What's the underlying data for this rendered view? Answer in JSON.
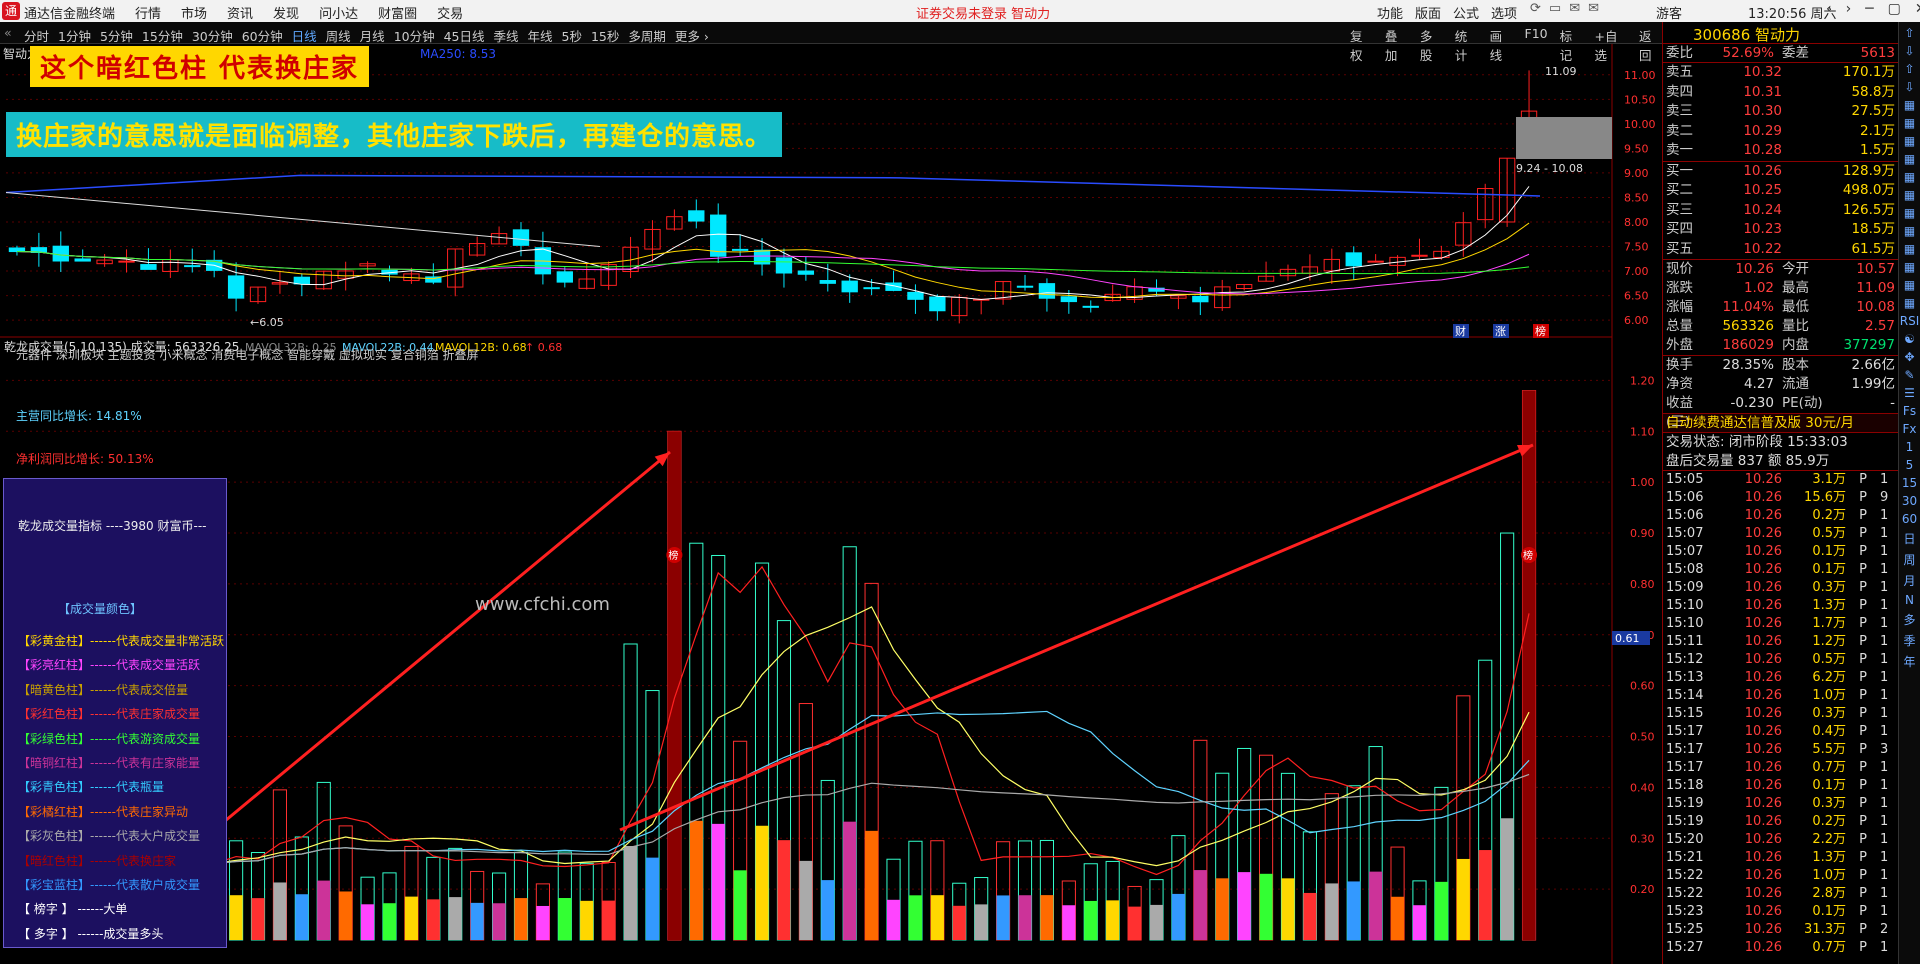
{
  "app": {
    "title": "通达信金融终端",
    "logo": "通",
    "menu": [
      "行情",
      "市场",
      "资讯",
      "发现",
      "问小达",
      "财富圈",
      "交易"
    ],
    "status": "证券交易未登录  智动力",
    "right_menu": [
      "功能",
      "版面",
      "公式",
      "选项"
    ],
    "guest": "游客",
    "clock": "13:20:56 周六",
    "window_controls": [
      "‹",
      "›",
      "─",
      "▢",
      "✕"
    ]
  },
  "tabs": {
    "arrow": "«",
    "items": [
      "分时",
      "1分钟",
      "5分钟",
      "15分钟",
      "30分钟",
      "60分钟",
      "日线",
      "周线",
      "月线",
      "10分钟",
      "45日线",
      "季线",
      "年线",
      "5秒",
      "15秒",
      "多周期",
      "更多 ›"
    ],
    "active": "日线",
    "right": [
      "复权",
      "叠加",
      "多股",
      "统计",
      "画线",
      "F10",
      "标记",
      "+自选",
      "返回"
    ]
  },
  "kline": {
    "name": "智动力",
    "ma_label": "MA250: 8.53",
    "ma_color": "#2a4cff",
    "high_label": "11.09",
    "low_label": "←6.05",
    "range_label": "9.24 - 10.08",
    "y_ticks": [
      "11.00",
      "10.50",
      "10.00",
      "9.50",
      "9.00",
      "8.50",
      "8.00",
      "7.50",
      "7.00",
      "6.50",
      "6.00"
    ],
    "badges": [
      "财",
      "涨",
      "榜"
    ]
  },
  "callouts": {
    "top": "这个暗红色柱   代表换庄家",
    "bottom": "换庄家的意思就是面临调整，其他庄家下跌后，再建仓的意思。"
  },
  "volume": {
    "indicator": "乾龙成交量(5,10,135)",
    "vol_label": "成交量: 563326.25",
    "mavol32b": "MAVOL32B: 0.25",
    "mavol22b": "MAVOL22B: 0.44",
    "mavol12b": "MAVOL12B: 0.68",
    "neg": "↑ 0.68",
    "concepts": "元器件 深圳板块 主题投资 小米概念 消费电子概念 智能穿戴 虚拟现实 复合铜箔 折叠屏",
    "rev_growth": "主营同比增长: 14.81%",
    "profit_growth": "净利润同比增长: 50.13%",
    "y_ticks": [
      "1.20",
      "1.10",
      "1.00",
      "0.90",
      "0.80",
      "0.70",
      "0.60",
      "0.50",
      "0.40",
      "0.30",
      "0.20"
    ],
    "current_tag": "0.61",
    "watermark": "www.cfchi.com",
    "bang": "榜"
  },
  "legend": {
    "title": "乾龙成交量指标 ----3980 财富币---",
    "subtitle": "【成交量颜色】",
    "rows": [
      {
        "text": "【彩黄金柱】------代表成交量非常活跃",
        "color": "#ffd700"
      },
      {
        "text": "【彩亮红柱】------代表成交量活跃",
        "color": "#ff44ff"
      },
      {
        "text": "【暗黄色柱】------代表成交倍量",
        "color": "#c8a000"
      },
      {
        "text": "【彩红色柱】------代表庄家成交量",
        "color": "#ff3030"
      },
      {
        "text": "【彩绿色柱】------代表游资成交量",
        "color": "#33ff33"
      },
      {
        "text": "【暗铜红柱】------代表有庄家能量",
        "color": "#cc3399"
      },
      {
        "text": "【彩青色柱】------代表瓶量",
        "color": "#33ccff"
      },
      {
        "text": "【彩橘红柱】------代表庄家异动",
        "color": "#ff6a00"
      },
      {
        "text": "【彩灰色柱】------代表大户成交量",
        "color": "#aaaaaa"
      },
      {
        "text": "【暗红色柱】------代表换庄家",
        "color": "#aa0000"
      },
      {
        "text": "【彩宝蓝柱】------代表散户成交量",
        "color": "#3399ff"
      },
      {
        "text": "【 榜字 】  ------大单",
        "color": "#ffffff"
      },
      {
        "text": "【 多字 】  ------成交量多头",
        "color": "#ffffff"
      }
    ]
  },
  "stock": {
    "code_name": "300686 智动力",
    "wb": {
      "l": "委比",
      "v": "52.69%",
      "l2": "委差",
      "v2": "5613"
    },
    "asks": [
      {
        "l": "卖五",
        "p": "10.32",
        "v": "170.1万"
      },
      {
        "l": "卖四",
        "p": "10.31",
        "v": "58.8万"
      },
      {
        "l": "卖三",
        "p": "10.30",
        "v": "27.5万"
      },
      {
        "l": "卖二",
        "p": "10.29",
        "v": "2.1万"
      },
      {
        "l": "卖一",
        "p": "10.28",
        "v": "1.5万"
      }
    ],
    "bids": [
      {
        "l": "买一",
        "p": "10.26",
        "v": "128.9万"
      },
      {
        "l": "买二",
        "p": "10.25",
        "v": "498.0万"
      },
      {
        "l": "买三",
        "p": "10.24",
        "v": "126.5万"
      },
      {
        "l": "买四",
        "p": "10.23",
        "v": "18.5万"
      },
      {
        "l": "买五",
        "p": "10.22",
        "v": "61.5万"
      }
    ],
    "quote": [
      {
        "l": "现价",
        "v": "10.26",
        "c1": "red",
        "l2": "今开",
        "v2": "10.57",
        "c2": "red"
      },
      {
        "l": "涨跌",
        "v": "1.02",
        "c1": "red",
        "l2": "最高",
        "v2": "11.09",
        "c2": "red"
      },
      {
        "l": "涨幅",
        "v": "11.04%",
        "c1": "red",
        "l2": "最低",
        "v2": "10.08",
        "c2": "red"
      },
      {
        "l": "总量",
        "v": "563326",
        "c1": "yel",
        "l2": "量比",
        "v2": "2.57",
        "c2": "red"
      },
      {
        "l": "外盘",
        "v": "186029",
        "c1": "red",
        "l2": "内盘",
        "v2": "377297",
        "c2": "grn"
      }
    ],
    "fund": [
      {
        "l": "换手",
        "v": "28.35%",
        "l2": "股本",
        "v2": "2.66亿"
      },
      {
        "l": "净资",
        "v": "4.27",
        "l2": "流通",
        "v2": "1.99亿"
      },
      {
        "l": "收益(三)",
        "v": "-0.230",
        "l2": "PE(动)",
        "v2": "-"
      }
    ],
    "promo": "自动续费通达信普及版  30元/月",
    "trade_state": "交易状态: 闭市阶段 15:33:03",
    "after_hours": "盘后交易量 837 额 85.9万",
    "ticks": [
      [
        "15:05",
        "10.26",
        "3.1万",
        "P",
        "1"
      ],
      [
        "15:06",
        "10.26",
        "15.6万",
        "P",
        "9"
      ],
      [
        "15:06",
        "10.26",
        "0.2万",
        "P",
        "1"
      ],
      [
        "15:07",
        "10.26",
        "0.5万",
        "P",
        "1"
      ],
      [
        "15:07",
        "10.26",
        "0.1万",
        "P",
        "1"
      ],
      [
        "15:08",
        "10.26",
        "0.1万",
        "P",
        "1"
      ],
      [
        "15:09",
        "10.26",
        "0.3万",
        "P",
        "1"
      ],
      [
        "15:10",
        "10.26",
        "1.3万",
        "P",
        "1"
      ],
      [
        "15:10",
        "10.26",
        "1.7万",
        "P",
        "1"
      ],
      [
        "15:11",
        "10.26",
        "1.2万",
        "P",
        "1"
      ],
      [
        "15:12",
        "10.26",
        "0.5万",
        "P",
        "1"
      ],
      [
        "15:13",
        "10.26",
        "6.2万",
        "P",
        "1"
      ],
      [
        "15:14",
        "10.26",
        "1.0万",
        "P",
        "1"
      ],
      [
        "15:15",
        "10.26",
        "0.3万",
        "P",
        "1"
      ],
      [
        "15:17",
        "10.26",
        "0.4万",
        "P",
        "1"
      ],
      [
        "15:17",
        "10.26",
        "5.5万",
        "P",
        "3"
      ],
      [
        "15:17",
        "10.26",
        "0.7万",
        "P",
        "1"
      ],
      [
        "15:18",
        "10.26",
        "0.1万",
        "P",
        "1"
      ],
      [
        "15:19",
        "10.26",
        "0.3万",
        "P",
        "1"
      ],
      [
        "15:19",
        "10.26",
        "0.2万",
        "P",
        "1"
      ],
      [
        "15:20",
        "10.26",
        "2.2万",
        "P",
        "1"
      ],
      [
        "15:21",
        "10.26",
        "1.3万",
        "P",
        "1"
      ],
      [
        "15:22",
        "10.26",
        "1.0万",
        "P",
        "1"
      ],
      [
        "15:22",
        "10.26",
        "2.8万",
        "P",
        "1"
      ],
      [
        "15:23",
        "10.26",
        "0.1万",
        "P",
        "1"
      ],
      [
        "15:25",
        "10.26",
        "31.3万",
        "P",
        "2"
      ],
      [
        "15:27",
        "10.26",
        "0.7万",
        "P",
        "1"
      ]
    ]
  },
  "side_icons": [
    "⇧",
    "⇩",
    "⇧",
    "⇩",
    "▦",
    "▦",
    "▦",
    "▦",
    "▦",
    "▦",
    "▦",
    "▦",
    "▦",
    "▦",
    "▦",
    "▦",
    "RSI",
    "☯",
    "✥",
    "✎",
    "☰",
    "Fs",
    "Fx",
    "1",
    "5",
    "15",
    "30",
    "60",
    "日",
    "周",
    "月",
    "N",
    "多",
    "季",
    "年"
  ]
}
